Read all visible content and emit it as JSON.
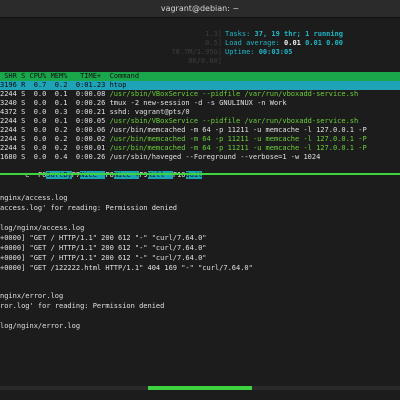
{
  "window": {
    "title": "vagrant@debian: ~"
  },
  "htop": {
    "meters": [
      "1.3]",
      "0.5]",
      "78.7M/1.95G]",
      "0K/0.00]"
    ],
    "tasks_label": "Tasks: ",
    "tasks_value": "37, 19 thr; 1 running",
    "load_label": "Load average: ",
    "load_1": "0.01",
    "load_rest": " 0.01 0.00",
    "uptime_label": "Uptime: ",
    "uptime_value": "00:03:05",
    "header": " SHR S CPU% MEM%   TIME+  Command",
    "rows": [
      {
        "pre": "3196 R  0.7  0.2  0:01.23 ",
        "cmd": "htop",
        "selected": true
      },
      {
        "pre": "2244 S  0.0  0.1  0:00.08 ",
        "cmd": "/usr/sbin/VBoxService --pidfile /var/run/vboxadd-service.sh",
        "green": true
      },
      {
        "pre": "3240 S  0.0  0.1  0:00.26 ",
        "cmd": "tmux -2 new-session -d -s GNULINUX -n Work"
      },
      {
        "pre": "4372 S  0.0  0.3  0:00.21 ",
        "cmd": "sshd: vagrant@pts/0"
      },
      {
        "pre": "2244 S  0.0  0.1  0:00.05 ",
        "cmd": "/usr/sbin/VBoxService --pidfile /var/run/vboxadd-service.sh",
        "green": true
      },
      {
        "pre": "2244 S  0.0  0.2  0:00.06 ",
        "cmd": "/usr/bin/memcached -m 64 -p 11211 -u memcache -l 127.0.0.1 -P"
      },
      {
        "pre": "2244 S  0.0  0.2  0:00.02 ",
        "cmd": "/usr/bin/memcached -m 64 -p 11211 -u memcache -l 127.0.0.1 -P",
        "green": true
      },
      {
        "pre": "2244 S  0.0  0.2  0:00.01 ",
        "cmd": "/usr/bin/memcached -m 64 -p 11211 -u memcache -l 127.0.0.1 -P",
        "green": true
      },
      {
        "pre": "1680 S  0.0  0.4  0:00.26 ",
        "cmd": "/usr/sbin/haveged --Foreground --verbose=1 -w 1024"
      }
    ],
    "fkeys": [
      {
        "key": "e  F6",
        "label": "SortBy"
      },
      {
        "key": "F7",
        "label": "Nice -"
      },
      {
        "key": "F8",
        "label": "Nice +"
      },
      {
        "key": "F9",
        "label": "Kill  "
      },
      {
        "key": "F10",
        "label": "Quit"
      }
    ]
  },
  "log1": {
    "lines": [
      "nginx/access.log",
      "access.log' for reading: Permission denied",
      "",
      "log/nginx/access.log",
      "+0000] \"GET / HTTP/1.1\" 200 612 \"-\" \"curl/7.64.0\"",
      "+0000] \"GET / HTTP/1.1\" 200 612 \"-\" \"curl/7.64.0\"",
      "+0000] \"GET / HTTP/1.1\" 200 612 \"-\" \"curl/7.64.0\"",
      "+0000] \"GET /122222.html HTTP/1.1\" 404 169 \"-\" \"curl/7.64.0\""
    ]
  },
  "log2": {
    "lines": [
      "nginx/error.log",
      "ror.log' for reading: Permission denied",
      "",
      "log/nginx/error.log"
    ]
  },
  "colors": {
    "green": "#3fd23f",
    "cyan": "#1fa3b8",
    "background": "#1c1c1c"
  }
}
